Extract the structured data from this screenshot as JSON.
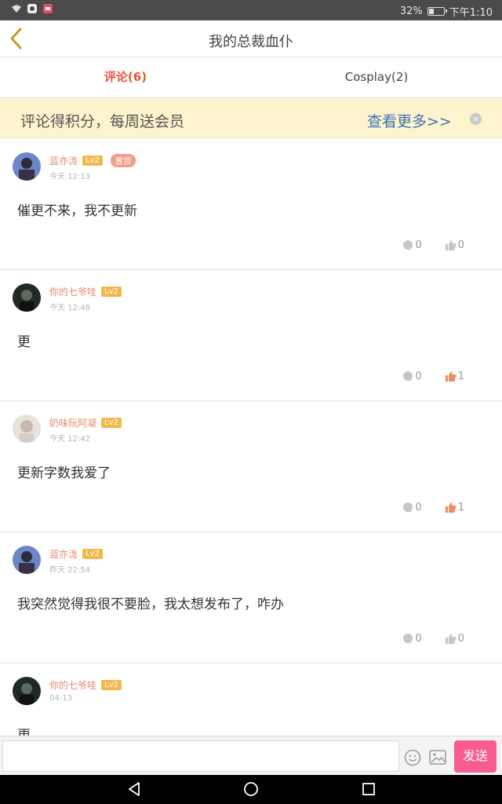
{
  "status_bar": {
    "battery": "32%",
    "time": "下午1:10"
  },
  "header": {
    "title": "我的总裁血仆"
  },
  "tabs": [
    {
      "label": "评论(6)"
    },
    {
      "label": "Cosplay(2)"
    }
  ],
  "banner": {
    "text": "评论得积分，每周送会员",
    "more": "查看更多>>"
  },
  "comments": [
    {
      "user": "蓝亦泷",
      "level": "Lv2",
      "pinned_label": "置顶",
      "time": "今天 12:13",
      "text": "催更不来，我不更新",
      "replies": "0",
      "likes": "0"
    },
    {
      "user": "你的七爷哇",
      "level": "Lv2",
      "time": "今天 12:48",
      "text": "更",
      "replies": "0",
      "likes": "1"
    },
    {
      "user": "奶味阮阿凝",
      "level": "Lv2",
      "time": "今天 12:42",
      "text": "更新字数我爱了",
      "replies": "0",
      "likes": "1"
    },
    {
      "user": "蓝亦泷",
      "level": "Lv2",
      "time": "昨天 22:54",
      "text": "我突然觉得我很不要脸，我太想发布了，咋办",
      "replies": "0",
      "likes": "0"
    },
    {
      "user": "你的七爷哇",
      "level": "Lv2",
      "time": "04-13",
      "text": "更"
    }
  ],
  "input": {
    "send_label": "发送"
  },
  "colors": {
    "accent_tab": "#e8563c",
    "banner_bg": "#fdf3cd",
    "link": "#3d74b6",
    "send_bg": "#f95c8e",
    "level_badge": "#f2b84a",
    "like_active": "#f08a5d"
  }
}
